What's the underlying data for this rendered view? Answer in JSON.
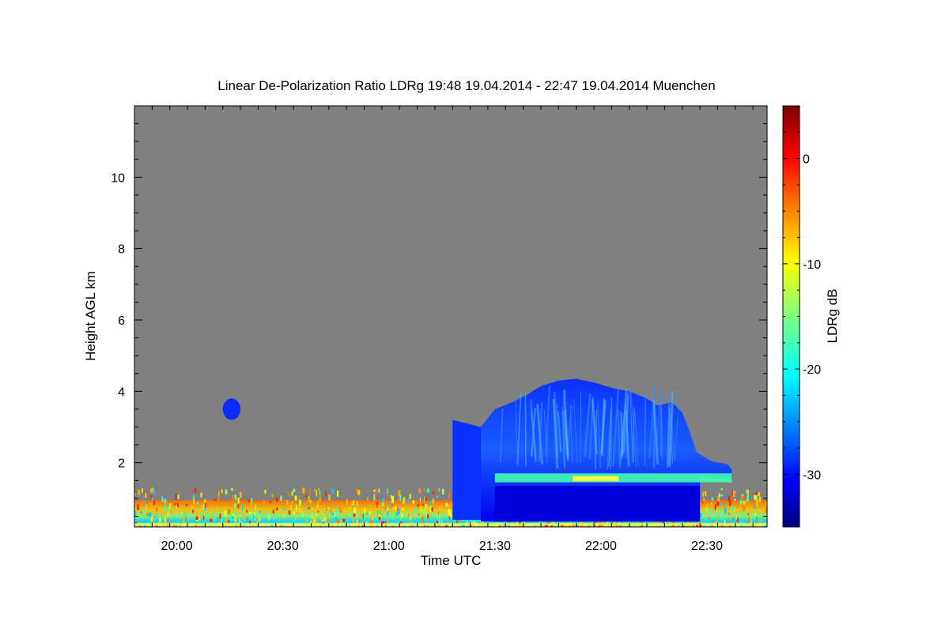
{
  "chart_data": {
    "type": "heatmap",
    "title": "Linear De-Polarization Ratio LDRg   19:48 19.04.2014 - 22:47 19.04.2014 Muenchen",
    "xlabel": "Time UTC",
    "ylabel": "Height AGL km",
    "colorbar_label": "LDRg dB",
    "x_range_minutes": [
      1188,
      1367
    ],
    "y_range_km": [
      0.2,
      12.0
    ],
    "x_ticks": [
      {
        "minutes": 1200,
        "label": "20:00"
      },
      {
        "minutes": 1230,
        "label": "20:30"
      },
      {
        "minutes": 1260,
        "label": "21:00"
      },
      {
        "minutes": 1290,
        "label": "21:30"
      },
      {
        "minutes": 1320,
        "label": "22:00"
      },
      {
        "minutes": 1350,
        "label": "22:30"
      }
    ],
    "y_ticks": [
      {
        "value": 2,
        "label": "2"
      },
      {
        "value": 4,
        "label": "4"
      },
      {
        "value": 6,
        "label": "6"
      },
      {
        "value": 8,
        "label": "8"
      },
      {
        "value": 10,
        "label": "10"
      }
    ],
    "colorbar_range_db": [
      -35,
      5
    ],
    "colorbar_ticks": [
      {
        "value": 0,
        "label": "0"
      },
      {
        "value": -10,
        "label": "-10"
      },
      {
        "value": -20,
        "label": "-20"
      },
      {
        "value": -30,
        "label": "-30"
      }
    ],
    "colormap": "jet",
    "background_color": "#808080",
    "features": [
      {
        "name": "near-surface-noise",
        "t_start": 1188,
        "t_end": 1367,
        "h_bottom": 0.2,
        "h_top": 1.3,
        "ldr_db": -10
      },
      {
        "name": "small-cloud-2015",
        "t_start": 1213,
        "t_end": 1218,
        "h_bottom": 3.2,
        "h_top": 3.8,
        "ldr_db": -31
      },
      {
        "name": "cloud-body",
        "t_start": 1285,
        "t_end": 1357,
        "h_bottom": 0.35,
        "h_top": 4.4,
        "ldr_db": -30
      },
      {
        "name": "melting-layer",
        "t_start": 1290,
        "t_end": 1357,
        "h_bottom": 1.45,
        "h_top": 1.7,
        "ldr_db": -16
      }
    ]
  }
}
